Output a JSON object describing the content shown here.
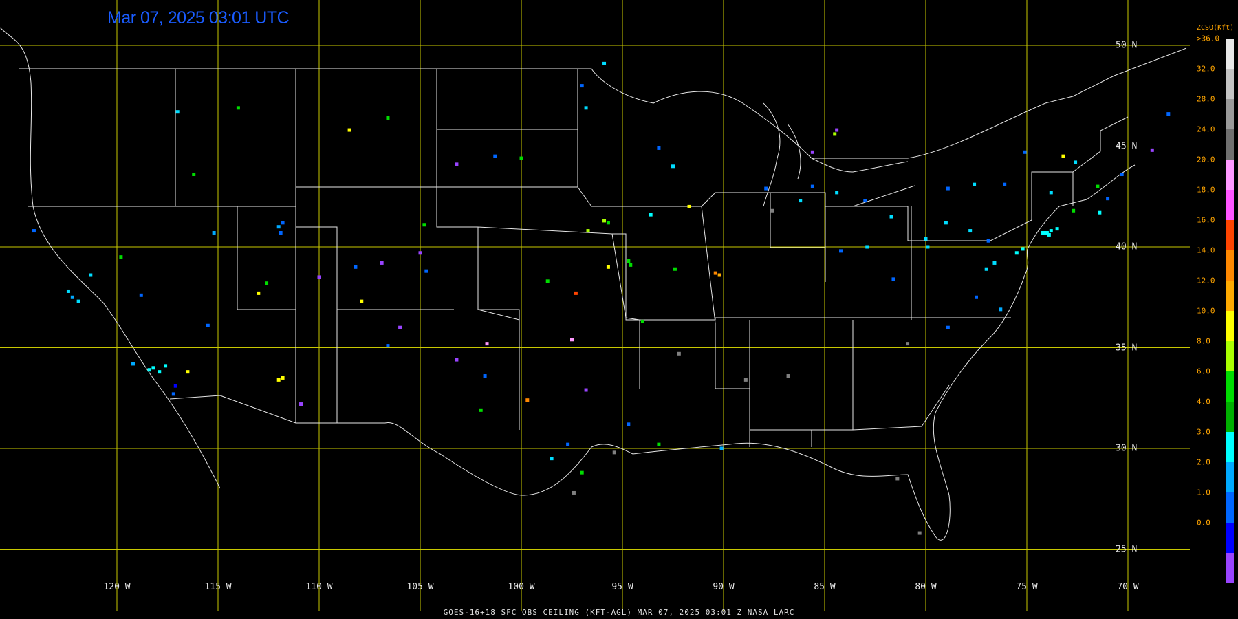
{
  "title": "Mar 07, 2025 03:01 UTC",
  "footer": "GOES-16+18  SFC OBS CEILING (KFT-AGL)  MAR 07, 2025 03:01 Z   NASA LARC",
  "legend": {
    "title": "ZCSO(Kft)",
    "labels": [
      ">36.0",
      "32.0",
      "28.0",
      "24.0",
      "20.0",
      "18.0",
      "16.0",
      "14.0",
      "12.0",
      "10.0",
      "8.0",
      "6.0",
      "4.0",
      "3.0",
      "2.0",
      "1.0",
      "0.0"
    ],
    "colors": [
      "#e8e8e8",
      "#c4c4c4",
      "#9a9a9a",
      "#707070",
      "#ff99ff",
      "#ff55ff",
      "#ff4400",
      "#ff8800",
      "#ffaa00",
      "#ffff00",
      "#aaff00",
      "#00dd00",
      "#00b000",
      "#00ffff",
      "#00aaff",
      "#0066ff",
      "#0000ff",
      "#9944ff"
    ]
  },
  "grid": {
    "longitudes": [
      "120 W",
      "115 W",
      "110 W",
      "105 W",
      "100 W",
      "95 W",
      "90 W",
      "85 W",
      "80 W",
      "75 W",
      "70 W"
    ],
    "latitudes": [
      "50 N",
      "45 N",
      "40 N",
      "35 N",
      "30 N",
      "25 N"
    ]
  },
  "stations": [
    {
      "lon": -122.4,
      "lat": 37.8,
      "c": "#00ddff"
    },
    {
      "lon": -122.2,
      "lat": 37.5,
      "c": "#00aaff"
    },
    {
      "lon": -121.9,
      "lat": 37.3,
      "c": "#00ddff"
    },
    {
      "lon": -118.2,
      "lat": 34.0,
      "c": "#00ffff"
    },
    {
      "lon": -118.4,
      "lat": 33.9,
      "c": "#00ffff"
    },
    {
      "lon": -117.9,
      "lat": 33.8,
      "c": "#00ffff"
    },
    {
      "lon": -117.2,
      "lat": 32.7,
      "c": "#0066ff"
    },
    {
      "lon": -117.1,
      "lat": 33.1,
      "c": "#0000ff"
    },
    {
      "lon": -116.5,
      "lat": 33.8,
      "c": "#ffff00"
    },
    {
      "lon": -117.6,
      "lat": 34.1,
      "c": "#00ffff"
    },
    {
      "lon": -119.2,
      "lat": 34.2,
      "c": "#00aaff"
    },
    {
      "lon": -115.5,
      "lat": 36.1,
      "c": "#0066ff"
    },
    {
      "lon": -112.0,
      "lat": 33.4,
      "c": "#ffff00"
    },
    {
      "lon": -111.8,
      "lat": 33.5,
      "c": "#ffff00"
    },
    {
      "lon": -110.9,
      "lat": 32.2,
      "c": "#9944ff"
    },
    {
      "lon": -111.9,
      "lat": 40.7,
      "c": "#0066ff"
    },
    {
      "lon": -111.8,
      "lat": 41.2,
      "c": "#0066ff"
    },
    {
      "lon": -112.0,
      "lat": 41.0,
      "c": "#00aaff"
    },
    {
      "lon": -116.2,
      "lat": 43.6,
      "c": "#00dd00"
    },
    {
      "lon": -117.0,
      "lat": 46.7,
      "c": "#00ddff"
    },
    {
      "lon": -114.0,
      "lat": 46.9,
      "c": "#00dd00"
    },
    {
      "lon": -108.5,
      "lat": 45.8,
      "c": "#ffff00"
    },
    {
      "lon": -106.6,
      "lat": 46.4,
      "c": "#00dd00"
    },
    {
      "lon": -104.8,
      "lat": 41.1,
      "c": "#00dd00"
    },
    {
      "lon": -105.0,
      "lat": 39.7,
      "c": "#9944ff"
    },
    {
      "lon": -104.7,
      "lat": 38.8,
      "c": "#0066ff"
    },
    {
      "lon": -106.9,
      "lat": 39.2,
      "c": "#9944ff"
    },
    {
      "lon": -107.9,
      "lat": 37.3,
      "c": "#ffff00"
    },
    {
      "lon": -106.6,
      "lat": 35.1,
      "c": "#0066ff"
    },
    {
      "lon": -103.2,
      "lat": 34.4,
      "c": "#9944ff"
    },
    {
      "lon": -101.7,
      "lat": 35.2,
      "c": "#ff99ff"
    },
    {
      "lon": -97.5,
      "lat": 35.4,
      "c": "#ff99ff"
    },
    {
      "lon": -96.8,
      "lat": 32.9,
      "c": "#9944ff"
    },
    {
      "lon": -97.7,
      "lat": 30.2,
      "c": "#0066ff"
    },
    {
      "lon": -95.4,
      "lat": 29.8,
      "c": "#808080"
    },
    {
      "lon": -98.5,
      "lat": 29.5,
      "c": "#00ddff"
    },
    {
      "lon": -97.4,
      "lat": 27.8,
      "c": "#808080"
    },
    {
      "lon": -94.7,
      "lat": 31.2,
      "c": "#0066ff"
    },
    {
      "lon": -92.2,
      "lat": 34.7,
      "c": "#808080"
    },
    {
      "lon": -90.1,
      "lat": 30.0,
      "c": "#00aaff"
    },
    {
      "lon": -88.9,
      "lat": 33.4,
      "c": "#808080"
    },
    {
      "lon": -86.8,
      "lat": 33.6,
      "c": "#808080"
    },
    {
      "lon": -96.7,
      "lat": 40.8,
      "c": "#aaff00"
    },
    {
      "lon": -95.9,
      "lat": 41.3,
      "c": "#aaff00"
    },
    {
      "lon": -95.7,
      "lat": 41.2,
      "c": "#00dd00"
    },
    {
      "lon": -93.6,
      "lat": 41.6,
      "c": "#00ffff"
    },
    {
      "lon": -93.2,
      "lat": 44.9,
      "c": "#0066ff"
    },
    {
      "lon": -92.5,
      "lat": 44.0,
      "c": "#00ddff"
    },
    {
      "lon": -91.7,
      "lat": 42.0,
      "c": "#ffff00"
    },
    {
      "lon": -90.2,
      "lat": 38.6,
      "c": "#ffaa00"
    },
    {
      "lon": -90.4,
      "lat": 38.7,
      "c": "#ff8800"
    },
    {
      "lon": -94.6,
      "lat": 39.1,
      "c": "#00dd00"
    },
    {
      "lon": -94.7,
      "lat": 39.3,
      "c": "#00dd00"
    },
    {
      "lon": -92.4,
      "lat": 38.9,
      "c": "#00dd00"
    },
    {
      "lon": -97.3,
      "lat": 37.7,
      "c": "#ff4400"
    },
    {
      "lon": -95.7,
      "lat": 39.0,
      "c": "#ffff00"
    },
    {
      "lon": -98.7,
      "lat": 38.3,
      "c": "#00dd00"
    },
    {
      "lon": -100.0,
      "lat": 44.4,
      "c": "#00dd00"
    },
    {
      "lon": -101.3,
      "lat": 44.5,
      "c": "#0066ff"
    },
    {
      "lon": -103.2,
      "lat": 44.1,
      "c": "#9944ff"
    },
    {
      "lon": -96.8,
      "lat": 46.9,
      "c": "#00ddff"
    },
    {
      "lon": -97.0,
      "lat": 48.0,
      "c": "#0066ff"
    },
    {
      "lon": -95.9,
      "lat": 49.1,
      "c": "#00ddff"
    },
    {
      "lon": -87.9,
      "lat": 42.9,
      "c": "#0066ff"
    },
    {
      "lon": -87.6,
      "lat": 41.8,
      "c": "#808080"
    },
    {
      "lon": -86.2,
      "lat": 42.3,
      "c": "#00ddff"
    },
    {
      "lon": -85.6,
      "lat": 44.7,
      "c": "#9944ff"
    },
    {
      "lon": -84.5,
      "lat": 45.6,
      "c": "#aaff00"
    },
    {
      "lon": -84.4,
      "lat": 45.8,
      "c": "#9944ff"
    },
    {
      "lon": -83.0,
      "lat": 42.3,
      "c": "#0066ff"
    },
    {
      "lon": -84.4,
      "lat": 42.7,
      "c": "#00ddff"
    },
    {
      "lon": -85.6,
      "lat": 43.0,
      "c": "#0066ff"
    },
    {
      "lon": -81.7,
      "lat": 41.5,
      "c": "#00ddff"
    },
    {
      "lon": -82.9,
      "lat": 40.0,
      "c": "#00ddff"
    },
    {
      "lon": -84.2,
      "lat": 39.8,
      "c": "#0066ff"
    },
    {
      "lon": -80.0,
      "lat": 40.4,
      "c": "#00ddff"
    },
    {
      "lon": -79.9,
      "lat": 40.0,
      "c": "#00ddff"
    },
    {
      "lon": -78.9,
      "lat": 42.9,
      "c": "#0066ff"
    },
    {
      "lon": -77.6,
      "lat": 43.1,
      "c": "#00ddff"
    },
    {
      "lon": -76.1,
      "lat": 43.1,
      "c": "#0066ff"
    },
    {
      "lon": -75.1,
      "lat": 44.7,
      "c": "#0066ff"
    },
    {
      "lon": -73.8,
      "lat": 42.7,
      "c": "#00ddff"
    },
    {
      "lon": -74.0,
      "lat": 40.7,
      "c": "#00ffff"
    },
    {
      "lon": -73.8,
      "lat": 40.8,
      "c": "#00ffff"
    },
    {
      "lon": -73.9,
      "lat": 40.6,
      "c": "#00ffff"
    },
    {
      "lon": -74.2,
      "lat": 40.7,
      "c": "#00ffff"
    },
    {
      "lon": -73.5,
      "lat": 40.9,
      "c": "#00ffff"
    },
    {
      "lon": -72.7,
      "lat": 41.8,
      "c": "#00dd00"
    },
    {
      "lon": -71.4,
      "lat": 41.7,
      "c": "#00ffff"
    },
    {
      "lon": -71.0,
      "lat": 42.4,
      "c": "#0066ff"
    },
    {
      "lon": -71.5,
      "lat": 43.0,
      "c": "#00dd00"
    },
    {
      "lon": -70.3,
      "lat": 43.6,
      "c": "#0066ff"
    },
    {
      "lon": -68.8,
      "lat": 44.8,
      "c": "#9944ff"
    },
    {
      "lon": -68.0,
      "lat": 46.6,
      "c": "#0066ff"
    },
    {
      "lon": -73.2,
      "lat": 44.5,
      "c": "#ffff00"
    },
    {
      "lon": -72.6,
      "lat": 44.2,
      "c": "#00ddff"
    },
    {
      "lon": -75.2,
      "lat": 39.9,
      "c": "#00ffff"
    },
    {
      "lon": -75.5,
      "lat": 39.7,
      "c": "#00ffff"
    },
    {
      "lon": -76.6,
      "lat": 39.2,
      "c": "#00ddff"
    },
    {
      "lon": -77.0,
      "lat": 38.9,
      "c": "#00ddff"
    },
    {
      "lon": -77.5,
      "lat": 37.5,
      "c": "#0066ff"
    },
    {
      "lon": -76.3,
      "lat": 36.9,
      "c": "#00aaff"
    },
    {
      "lon": -78.9,
      "lat": 36.0,
      "c": "#0066ff"
    },
    {
      "lon": -80.9,
      "lat": 35.2,
      "c": "#808080"
    },
    {
      "lon": -81.6,
      "lat": 38.4,
      "c": "#0066ff"
    },
    {
      "lon": -79.0,
      "lat": 41.2,
      "c": "#00ddff"
    },
    {
      "lon": -77.8,
      "lat": 40.8,
      "c": "#00ddff"
    },
    {
      "lon": -76.9,
      "lat": 40.3,
      "c": "#0066ff"
    },
    {
      "lon": -80.3,
      "lat": 25.8,
      "c": "#808080"
    },
    {
      "lon": -81.4,
      "lat": 28.5,
      "c": "#808080"
    },
    {
      "lon": -106.0,
      "lat": 36.0,
      "c": "#9944ff"
    },
    {
      "lon": -108.2,
      "lat": 39.0,
      "c": "#0066ff"
    },
    {
      "lon": -110.0,
      "lat": 38.5,
      "c": "#9944ff"
    },
    {
      "lon": -113.0,
      "lat": 37.7,
      "c": "#ffff00"
    },
    {
      "lon": -112.6,
      "lat": 38.2,
      "c": "#00dd00"
    },
    {
      "lon": -115.2,
      "lat": 40.7,
      "c": "#00aaff"
    },
    {
      "lon": -119.8,
      "lat": 39.5,
      "c": "#00dd00"
    },
    {
      "lon": -118.8,
      "lat": 37.6,
      "c": "#0066ff"
    },
    {
      "lon": -121.3,
      "lat": 38.6,
      "c": "#00ddff"
    },
    {
      "lon": -124.1,
      "lat": 40.8,
      "c": "#0066ff"
    },
    {
      "lon": -102.0,
      "lat": 31.9,
      "c": "#00dd00"
    },
    {
      "lon": -101.8,
      "lat": 33.6,
      "c": "#0066ff"
    },
    {
      "lon": -99.7,
      "lat": 32.4,
      "c": "#ff8800"
    },
    {
      "lon": -97.0,
      "lat": 28.8,
      "c": "#00dd00"
    },
    {
      "lon": -93.2,
      "lat": 30.2,
      "c": "#00dd00"
    },
    {
      "lon": -94.0,
      "lat": 36.3,
      "c": "#00dd00"
    }
  ]
}
